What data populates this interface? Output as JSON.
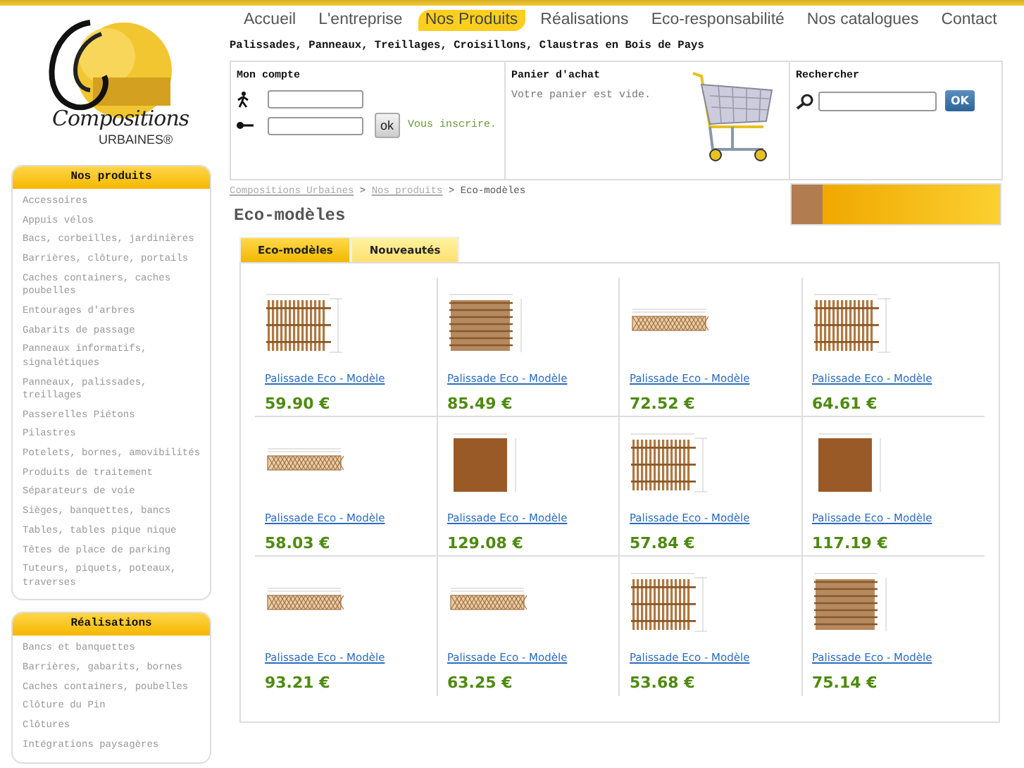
{
  "logo": {
    "name": "Compositions",
    "subtitle": "URBAINES®"
  },
  "nav": [
    {
      "label": "Accueil",
      "selected": false
    },
    {
      "label": "L'entreprise",
      "selected": false
    },
    {
      "label": "Nos Produits",
      "selected": true
    },
    {
      "label": "Réalisations",
      "selected": false
    },
    {
      "label": "Eco-responsabilité",
      "selected": false
    },
    {
      "label": "Nos catalogues",
      "selected": false
    },
    {
      "label": "Contact",
      "selected": false
    }
  ],
  "sidebar": [
    {
      "title": "Nos produits",
      "items": [
        "Accessoires",
        "Appuis vélos",
        "Bacs, corbeilles, jardinières",
        "Barrières, clôture, portails",
        "Caches containers, caches poubelles",
        "Entourages d'arbres",
        "Gabarits de passage",
        "Panneaux informatifs, signalétiques",
        "Panneaux, palissades, treillages",
        "Passerelles Piétons",
        "Pilastres",
        "Potelets, bornes, amovibilités",
        "Produits de traitement",
        "Séparateurs de voie",
        "Sièges, banquettes, bancs",
        "Tables, tables pique nique",
        "Têtes de place de parking",
        "Tuteurs, piquets, poteaux, traverses"
      ]
    },
    {
      "title": "Réalisations",
      "items": [
        "Bancs et banquettes",
        "Barrières, gabarits, bornes",
        "Caches containers, poubelles",
        "Clôture du Pin",
        "Clôtures",
        "Intégrations paysagères"
      ]
    }
  ],
  "tagline": "Palissades, Panneaux, Treillages, Croisillons, Claustras en Bois de Pays",
  "account": {
    "title": "Mon compte",
    "button": "ok",
    "link": "Vous inscrire."
  },
  "cart": {
    "title": "Panier d'achat",
    "message": "Votre panier est vide."
  },
  "search": {
    "title": "Rechercher",
    "button": "OK"
  },
  "breadcrumb": {
    "links": [
      "Compositions Urbaines",
      "Nos produits"
    ],
    "separator": ">",
    "current": "Eco-modèles"
  },
  "page_title": "Eco-modèles",
  "tabs": [
    {
      "label": "Eco-modèles",
      "selected": true
    },
    {
      "label": "Nouveautés",
      "selected": false
    }
  ],
  "products": [
    {
      "kind": "slats",
      "name": "Palissade Eco - Modèle",
      "price": "59.90 €"
    },
    {
      "kind": "boards",
      "name": "Palissade Eco - Modèle",
      "price": "85.49 €"
    },
    {
      "kind": "lattice",
      "name": "Palissade Eco - Modèle",
      "price": "72.52 €"
    },
    {
      "kind": "slats",
      "name": "Palissade Eco - Modèle",
      "price": "64.61 €"
    },
    {
      "kind": "lattice",
      "name": "Palissade Eco - Modèle",
      "price": "58.03 €"
    },
    {
      "kind": "solid",
      "name": "Palissade Eco - Modèle",
      "price": "129.08 €"
    },
    {
      "kind": "slats",
      "name": "Palissade Eco - Modèle",
      "price": "57.84 €"
    },
    {
      "kind": "solid",
      "name": "Palissade Eco - Modèle",
      "price": "117.19 €"
    },
    {
      "kind": "lattice",
      "name": "Palissade Eco - Modèle",
      "price": "93.21 €"
    },
    {
      "kind": "lattice",
      "name": "Palissade Eco - Modèle",
      "price": "63.25 €"
    },
    {
      "kind": "slats",
      "name": "Palissade Eco - Modèle",
      "price": "53.68 €"
    },
    {
      "kind": "boards",
      "name": "Palissade Eco - Modèle",
      "price": "75.14 €"
    }
  ]
}
